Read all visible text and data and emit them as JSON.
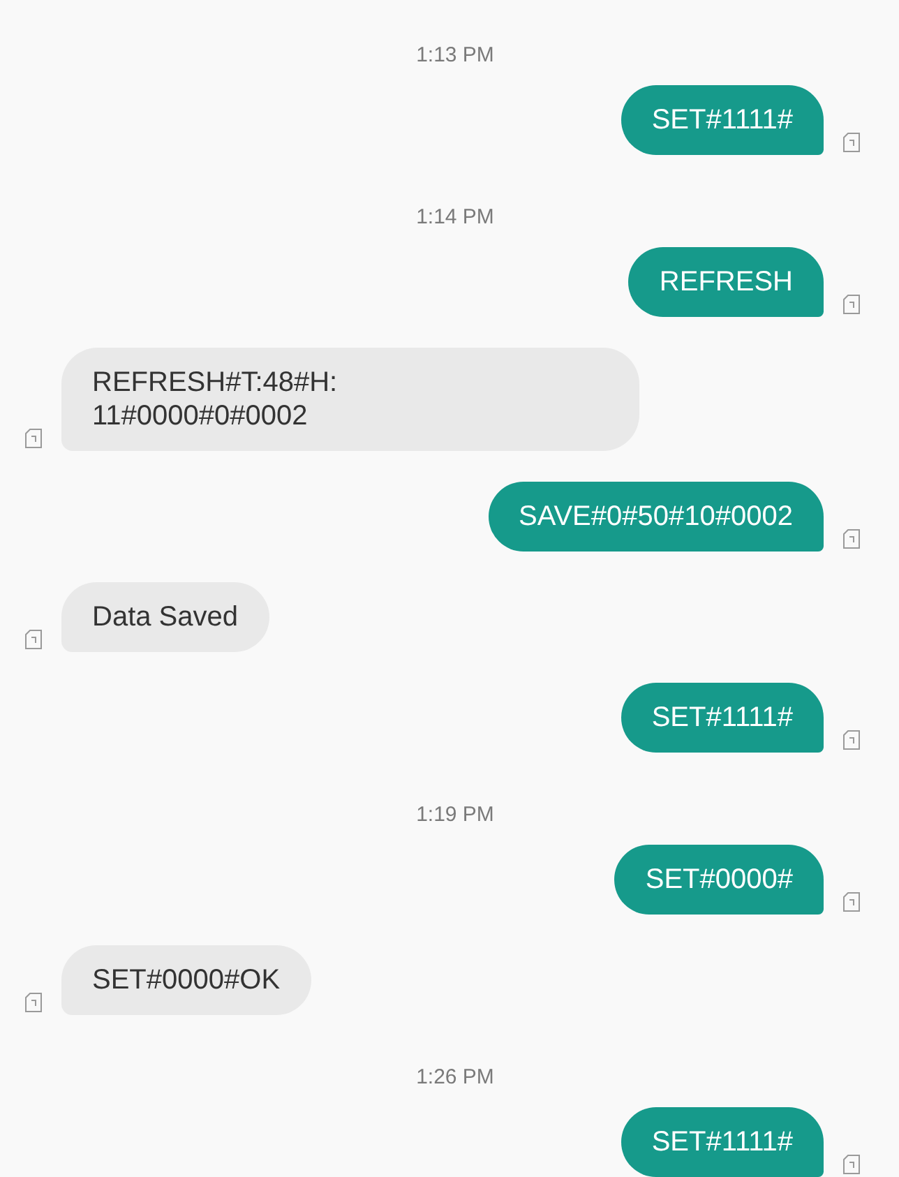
{
  "messages": [
    {
      "kind": "time",
      "text": "1:13 PM"
    },
    {
      "kind": "sent",
      "text": "SET#1111#"
    },
    {
      "kind": "time",
      "text": "1:14 PM"
    },
    {
      "kind": "sent",
      "text": "REFRESH"
    },
    {
      "kind": "received",
      "text": "REFRESH#T:48#H:\n11#0000#0#0002"
    },
    {
      "kind": "sent",
      "text": "SAVE#0#50#10#0002"
    },
    {
      "kind": "received",
      "text": "Data Saved"
    },
    {
      "kind": "sent",
      "text": "SET#1111#"
    },
    {
      "kind": "time",
      "text": "1:19 PM"
    },
    {
      "kind": "sent",
      "text": "SET#0000#"
    },
    {
      "kind": "received",
      "text": "SET#0000#OK"
    },
    {
      "kind": "time",
      "text": "1:26 PM"
    },
    {
      "kind": "sent",
      "text": "SET#1111#"
    }
  ]
}
